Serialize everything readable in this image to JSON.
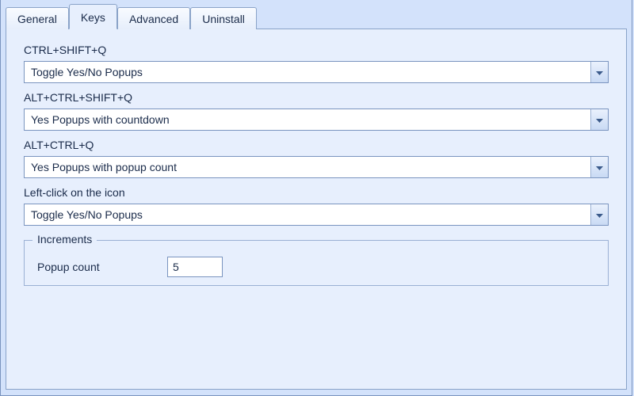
{
  "tabs": {
    "general": "General",
    "keys": "Keys",
    "advanced": "Advanced",
    "uninstall": "Uninstall",
    "active": "keys"
  },
  "keys": {
    "hotkey1": {
      "label": "CTRL+SHIFT+Q",
      "value": "Toggle Yes/No Popups"
    },
    "hotkey2": {
      "label": "ALT+CTRL+SHIFT+Q",
      "value": "Yes Popups with countdown"
    },
    "hotkey3": {
      "label": "ALT+CTRL+Q",
      "value": "Yes Popups with popup count"
    },
    "leftclick": {
      "label": "Left-click on the icon",
      "value": "Toggle Yes/No Popups"
    }
  },
  "increments": {
    "legend": "Increments",
    "popup_count": {
      "label": "Popup count",
      "value": "5"
    }
  }
}
